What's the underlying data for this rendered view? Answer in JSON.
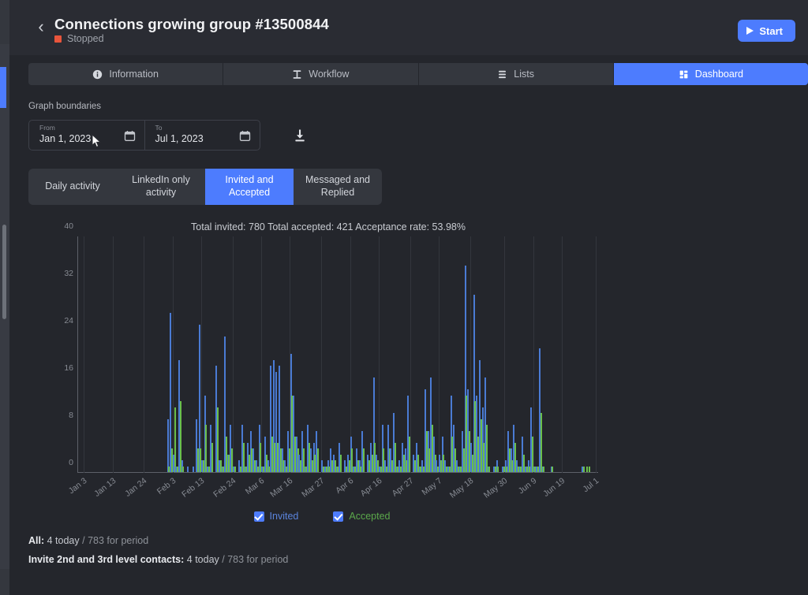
{
  "header": {
    "back_icon": "chevron-left-icon",
    "title": "Connections growing group #13500844",
    "status": "Stopped",
    "status_color": "#e8553c",
    "start_label": "Start"
  },
  "tabs": [
    {
      "label": "Information",
      "icon": "info-icon",
      "active": false
    },
    {
      "label": "Workflow",
      "icon": "workflow-icon",
      "active": false
    },
    {
      "label": "Lists",
      "icon": "list-icon",
      "active": false
    },
    {
      "label": "Dashboard",
      "icon": "dashboard-icon",
      "active": true
    }
  ],
  "boundaries": {
    "label": "Graph boundaries",
    "from": {
      "caption": "From",
      "value": "Jan 1, 2023",
      "icon": "calendar-icon"
    },
    "to": {
      "caption": "To",
      "value": "Jul 1, 2023",
      "icon": "calendar-icon"
    },
    "download_icon": "download-icon"
  },
  "segments": [
    {
      "label": "Daily activity",
      "active": false
    },
    {
      "label": "LinkedIn only activity",
      "active": false
    },
    {
      "label": "Invited and Accepted",
      "active": true
    },
    {
      "label": "Messaged and Replied",
      "active": false
    }
  ],
  "legend": [
    {
      "label": "Invited",
      "color": "#5b84dd",
      "checked": true
    },
    {
      "label": "Accepted",
      "color": "#5ba84b",
      "checked": true
    }
  ],
  "footer": {
    "line1": {
      "strong": "All:",
      "mid": "4 today",
      "rest": "/ 783 for period"
    },
    "line2": {
      "strong": "Invite 2nd and 3rd level contacts:",
      "mid": "4 today",
      "rest": "/ 783 for period"
    }
  },
  "colors": {
    "accent": "#4d7cfe",
    "invited": "#4a7bd4",
    "accepted": "#6abf4b",
    "page_bg": "#24262c",
    "header_bg": "#2a2c33",
    "panel_bg": "#34373e",
    "status_red": "#e8553c"
  },
  "chart_data": {
    "type": "bar",
    "title": "Total invited: 780  Total accepted: 421  Acceptance rate: 53.98%",
    "stats": {
      "total_invited": 780,
      "total_accepted": 421,
      "acceptance_rate": "53.98%"
    },
    "xlabel": "",
    "ylabel": "",
    "ylim": [
      0,
      40
    ],
    "yticks": [
      0,
      8,
      16,
      24,
      32,
      40
    ],
    "grid": true,
    "legend_position": "bottom",
    "date_range": {
      "from": "Jan 1, 2023",
      "to": "Jul 1, 2023"
    },
    "xticks": [
      "Jan 3",
      "Jan 13",
      "Jan 24",
      "Feb 3",
      "Feb 13",
      "Feb 24",
      "Mar 6",
      "Mar 16",
      "Mar 27",
      "Apr 6",
      "Apr 16",
      "Apr 27",
      "May 7",
      "May 18",
      "May 30",
      "Jun 9",
      "Jun 19",
      "Jul 1"
    ],
    "xtick_positions": [
      2,
      12,
      23,
      33,
      43,
      54,
      64,
      74,
      85,
      95,
      105,
      116,
      126,
      137,
      149,
      159,
      169,
      181
    ],
    "n_points": 182,
    "series": [
      {
        "name": "Invited",
        "color": "#4a7bd4",
        "values": [
          0,
          0,
          0,
          0,
          0,
          0,
          0,
          0,
          0,
          0,
          0,
          0,
          0,
          0,
          0,
          0,
          0,
          0,
          0,
          0,
          0,
          0,
          0,
          0,
          0,
          0,
          0,
          0,
          0,
          0,
          0,
          9,
          27,
          3,
          1,
          19,
          2,
          0,
          1,
          0,
          1,
          9,
          25,
          2,
          13,
          1,
          8,
          0,
          18,
          2,
          1,
          23,
          3,
          8,
          1,
          0,
          2,
          8,
          1,
          5,
          7,
          4,
          2,
          8,
          1,
          6,
          2,
          18,
          19,
          17,
          18,
          4,
          2,
          7,
          20,
          13,
          6,
          3,
          7,
          1,
          8,
          4,
          5,
          7,
          0,
          2,
          1,
          2,
          4,
          3,
          1,
          5,
          0,
          2,
          3,
          6,
          1,
          4,
          2,
          7,
          0,
          3,
          5,
          16,
          3,
          1,
          8,
          2,
          8,
          4,
          10,
          1,
          2,
          5,
          4,
          13,
          0,
          3,
          5,
          1,
          2,
          14,
          7,
          16,
          6,
          2,
          3,
          6,
          2,
          1,
          13,
          8,
          2,
          1,
          7,
          35,
          14,
          5,
          30,
          13,
          19,
          11,
          16,
          1,
          0,
          1,
          2,
          0,
          1,
          2,
          7,
          4,
          8,
          2,
          1,
          6,
          1,
          2,
          11,
          1,
          1,
          21,
          1,
          0,
          0,
          1,
          0,
          0,
          0,
          0,
          0,
          0,
          0,
          0,
          0,
          0,
          1,
          0,
          0,
          0,
          0,
          0
        ]
      },
      {
        "name": "Accepted",
        "color": "#6abf4b",
        "values": [
          0,
          0,
          0,
          0,
          0,
          0,
          0,
          0,
          0,
          0,
          0,
          0,
          0,
          0,
          0,
          0,
          0,
          0,
          0,
          0,
          0,
          0,
          0,
          0,
          0,
          0,
          0,
          0,
          0,
          0,
          0,
          1,
          4,
          11,
          1,
          12,
          1,
          0,
          0,
          0,
          0,
          4,
          4,
          2,
          8,
          1,
          5,
          0,
          11,
          2,
          1,
          6,
          3,
          4,
          1,
          0,
          1,
          5,
          1,
          3,
          4,
          2,
          1,
          5,
          1,
          3,
          1,
          6,
          5,
          5,
          4,
          2,
          1,
          4,
          13,
          6,
          4,
          2,
          4,
          1,
          5,
          2,
          3,
          4,
          0,
          1,
          1,
          1,
          2,
          2,
          1,
          3,
          0,
          1,
          2,
          4,
          1,
          2,
          1,
          4,
          0,
          2,
          3,
          5,
          2,
          1,
          4,
          1,
          4,
          2,
          5,
          1,
          1,
          3,
          2,
          6,
          0,
          2,
          3,
          1,
          1,
          7,
          4,
          8,
          3,
          1,
          2,
          3,
          1,
          1,
          6,
          4,
          1,
          1,
          4,
          13,
          7,
          3,
          12,
          6,
          9,
          5,
          8,
          1,
          0,
          1,
          1,
          0,
          1,
          1,
          4,
          2,
          5,
          1,
          1,
          3,
          1,
          1,
          6,
          1,
          1,
          10,
          1,
          0,
          0,
          1,
          0,
          0,
          0,
          0,
          0,
          0,
          0,
          0,
          0,
          0,
          1,
          1,
          1,
          0,
          0,
          0
        ]
      }
    ]
  }
}
